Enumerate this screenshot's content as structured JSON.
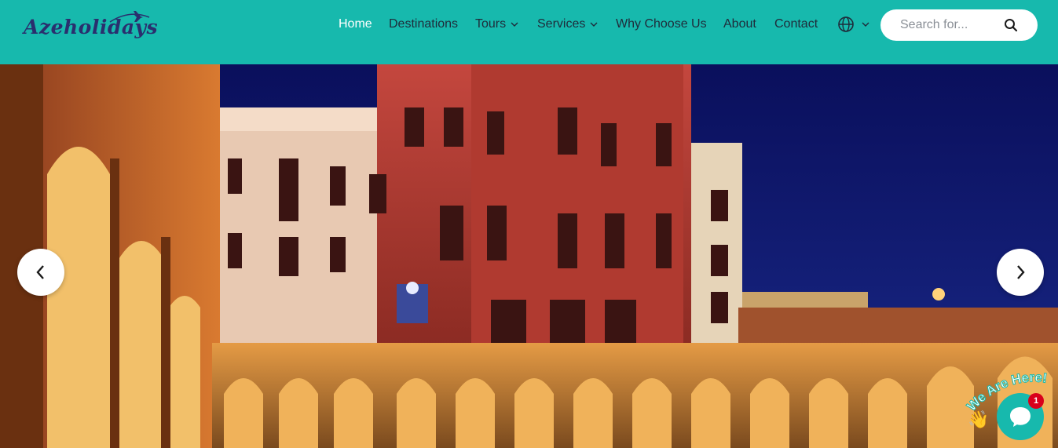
{
  "brand": {
    "name": "Azeholidays",
    "icon": "airplane-logo-icon"
  },
  "nav": {
    "items": [
      {
        "label": "Home",
        "active": true
      },
      {
        "label": "Destinations",
        "active": false
      },
      {
        "label": "Tours",
        "active": false,
        "dropdown": true
      },
      {
        "label": "Services",
        "active": false,
        "dropdown": true
      },
      {
        "label": "Why Choose Us",
        "active": false
      },
      {
        "label": "About",
        "active": false
      },
      {
        "label": "Contact",
        "active": false
      }
    ],
    "language_icon": "globe-icon"
  },
  "search": {
    "placeholder": "Search for...",
    "value": "",
    "icon": "search-icon"
  },
  "hero": {
    "prev_icon": "chevron-left-icon",
    "next_icon": "chevron-right-icon"
  },
  "chat_widget": {
    "callout": "We Are Here!",
    "unread_count": "1",
    "icon": "chat-bubble-icon"
  },
  "colors": {
    "header": "#17b9ad",
    "active_nav": "#ffffff",
    "nav_text": "#1f2b3a",
    "logo": "#2a2f6e"
  }
}
